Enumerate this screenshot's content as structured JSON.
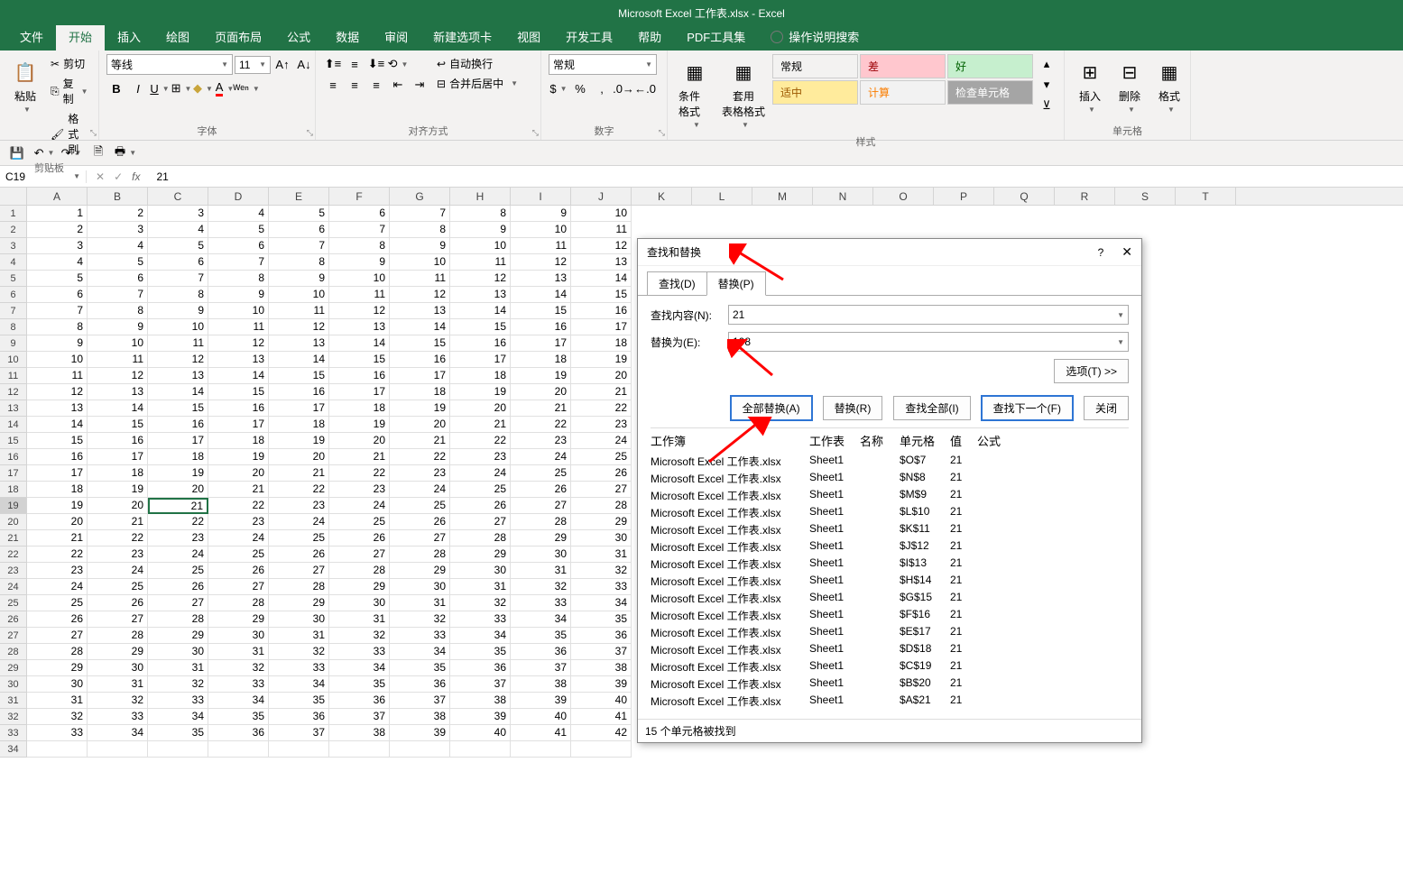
{
  "app": {
    "title": "Microsoft Excel 工作表.xlsx  -  Excel"
  },
  "tabs": {
    "file": "文件",
    "home": "开始",
    "insert": "插入",
    "draw": "绘图",
    "layout": "页面布局",
    "formulas": "公式",
    "data": "数据",
    "review": "审阅",
    "newtab": "新建选项卡",
    "view": "视图",
    "developer": "开发工具",
    "help": "帮助",
    "pdf": "PDF工具集",
    "tell_me": "操作说明搜索"
  },
  "ribbon": {
    "clipboard": {
      "label": "剪贴板",
      "paste": "粘贴",
      "cut": "剪切",
      "copy": "复制",
      "format_painter": "格式刷"
    },
    "font": {
      "label": "字体",
      "name": "等线",
      "size": "11"
    },
    "alignment": {
      "label": "对齐方式",
      "wrap": "自动换行",
      "merge": "合并后居中"
    },
    "number": {
      "label": "数字",
      "format": "常规"
    },
    "styles": {
      "label": "样式",
      "cond_format": "条件格式",
      "table_format": "套用\n表格格式",
      "cells": {
        "normal": "常规",
        "bad": "差",
        "good": "好",
        "neutral": "适中",
        "calc": "计算",
        "check": "检查单元格"
      }
    },
    "cells": {
      "label": "单元格",
      "insert": "插入",
      "delete": "删除",
      "format": "格式"
    }
  },
  "formula_bar": {
    "cell_ref": "C19",
    "value": "21"
  },
  "columns": [
    "A",
    "B",
    "C",
    "D",
    "E",
    "F",
    "G",
    "H",
    "I",
    "J",
    "K",
    "L",
    "M",
    "N",
    "O",
    "P",
    "Q",
    "R",
    "S",
    "T"
  ],
  "grid": {
    "rows": 34,
    "start_values": [
      1,
      2,
      3,
      4,
      5,
      6,
      7,
      8,
      9,
      10
    ],
    "active_cell": {
      "row": 19,
      "col": 3
    }
  },
  "dialog": {
    "title": "查找和替换",
    "tab_find": "查找(D)",
    "tab_replace": "替换(P)",
    "find_label": "查找内容(N):",
    "find_value": "21",
    "replace_label": "替换为(E):",
    "replace_value": "108",
    "options_btn": "选项(T) >>",
    "btn_replace_all": "全部替换(A)",
    "btn_replace": "替换(R)",
    "btn_find_all": "查找全部(I)",
    "btn_find_next": "查找下一个(F)",
    "btn_close": "关闭",
    "headers": {
      "wb": "工作簿",
      "sh": "工作表",
      "nm": "名称",
      "cl": "单元格",
      "vl": "值",
      "fm": "公式"
    },
    "results": [
      {
        "wb": "Microsoft Excel 工作表.xlsx",
        "sh": "Sheet1",
        "cl": "$O$7",
        "vl": "21"
      },
      {
        "wb": "Microsoft Excel 工作表.xlsx",
        "sh": "Sheet1",
        "cl": "$N$8",
        "vl": "21"
      },
      {
        "wb": "Microsoft Excel 工作表.xlsx",
        "sh": "Sheet1",
        "cl": "$M$9",
        "vl": "21"
      },
      {
        "wb": "Microsoft Excel 工作表.xlsx",
        "sh": "Sheet1",
        "cl": "$L$10",
        "vl": "21"
      },
      {
        "wb": "Microsoft Excel 工作表.xlsx",
        "sh": "Sheet1",
        "cl": "$K$11",
        "vl": "21"
      },
      {
        "wb": "Microsoft Excel 工作表.xlsx",
        "sh": "Sheet1",
        "cl": "$J$12",
        "vl": "21"
      },
      {
        "wb": "Microsoft Excel 工作表.xlsx",
        "sh": "Sheet1",
        "cl": "$I$13",
        "vl": "21"
      },
      {
        "wb": "Microsoft Excel 工作表.xlsx",
        "sh": "Sheet1",
        "cl": "$H$14",
        "vl": "21"
      },
      {
        "wb": "Microsoft Excel 工作表.xlsx",
        "sh": "Sheet1",
        "cl": "$G$15",
        "vl": "21"
      },
      {
        "wb": "Microsoft Excel 工作表.xlsx",
        "sh": "Sheet1",
        "cl": "$F$16",
        "vl": "21"
      },
      {
        "wb": "Microsoft Excel 工作表.xlsx",
        "sh": "Sheet1",
        "cl": "$E$17",
        "vl": "21"
      },
      {
        "wb": "Microsoft Excel 工作表.xlsx",
        "sh": "Sheet1",
        "cl": "$D$18",
        "vl": "21"
      },
      {
        "wb": "Microsoft Excel 工作表.xlsx",
        "sh": "Sheet1",
        "cl": "$C$19",
        "vl": "21"
      },
      {
        "wb": "Microsoft Excel 工作表.xlsx",
        "sh": "Sheet1",
        "cl": "$B$20",
        "vl": "21"
      },
      {
        "wb": "Microsoft Excel 工作表.xlsx",
        "sh": "Sheet1",
        "cl": "$A$21",
        "vl": "21"
      }
    ],
    "status": "15 个单元格被找到"
  }
}
